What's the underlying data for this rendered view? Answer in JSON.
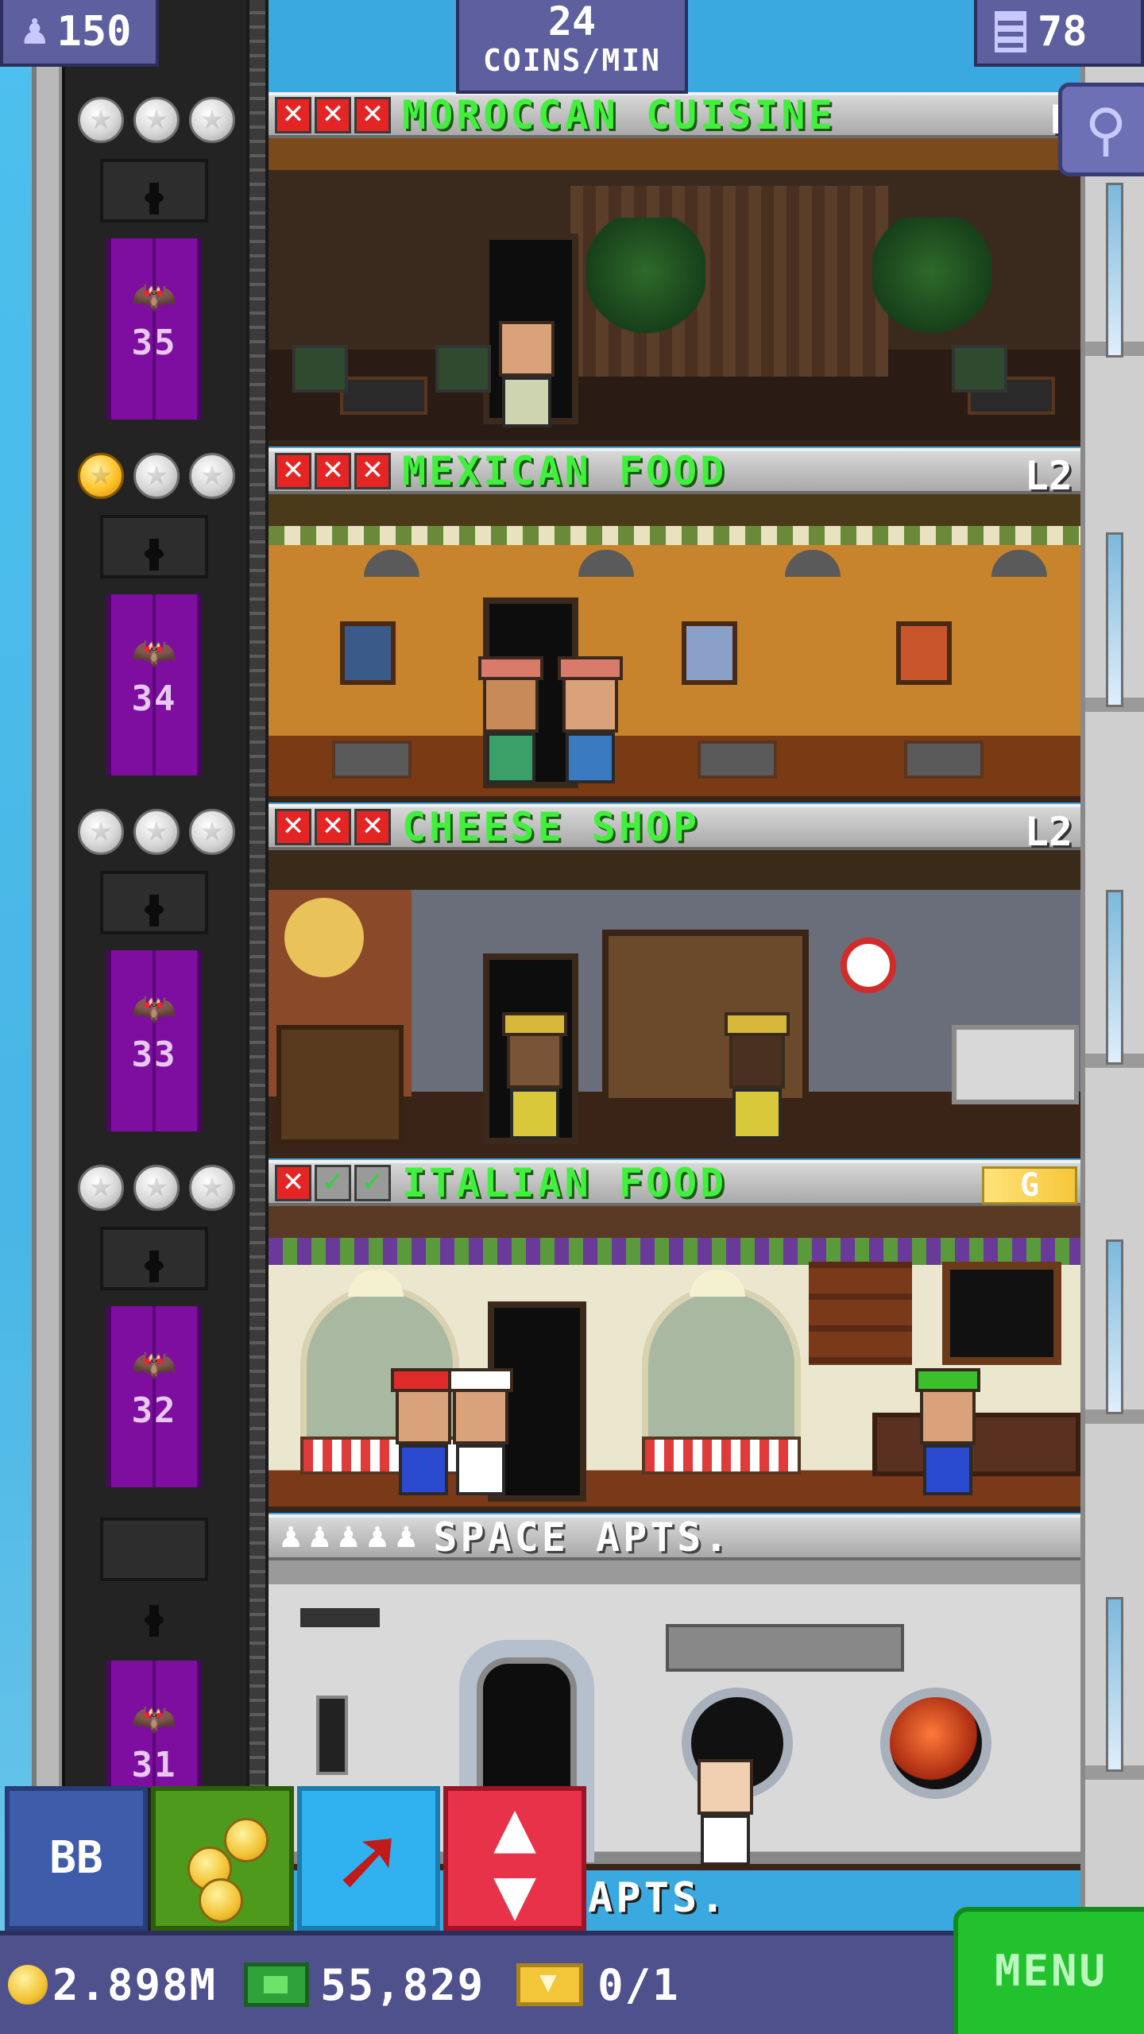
{
  "hud": {
    "population": "150",
    "coins_per_min_value": "24",
    "coins_per_min_label": "COINS/MIN",
    "floor_count": "78"
  },
  "shaft": {
    "floors": [
      {
        "number": "35",
        "stars": [
          "silver",
          "silver",
          "silver"
        ]
      },
      {
        "number": "34",
        "stars": [
          "gold",
          "silver",
          "silver"
        ]
      },
      {
        "number": "33",
        "stars": [
          "silver",
          "silver",
          "silver"
        ]
      },
      {
        "number": "32",
        "stars": [
          "silver",
          "silver",
          "silver"
        ]
      },
      {
        "number": "31",
        "stars": []
      }
    ]
  },
  "rooms": [
    {
      "name": "MOROCCAN CUISINE",
      "level": "L",
      "marks": [
        "x",
        "x",
        "x"
      ],
      "bg": "#3a2a1e"
    },
    {
      "name": "MEXICAN FOOD",
      "level": "L2",
      "marks": [
        "x",
        "x",
        "x"
      ],
      "bg": "#b86a22"
    },
    {
      "name": "CHEESE SHOP",
      "level": "L2",
      "marks": [
        "x",
        "x",
        "x"
      ],
      "bg": "#5a4a3a"
    },
    {
      "name": "ITALIAN FOOD",
      "level": "G",
      "marks": [
        "x",
        "ok",
        "ok"
      ],
      "bg": "#e9e6cf"
    },
    {
      "name": "SPACE APTS.",
      "residents": "♟♟♟♟♟",
      "bg": "#d7d7d7"
    }
  ],
  "lower_room_label": "APTS.",
  "buttons": {
    "bb_label": "BB",
    "menu_label": "MENU"
  },
  "bottom": {
    "coins": "2.898M",
    "bux": "55,829",
    "tickets": "0/1"
  },
  "icons": {
    "population": "person-icon",
    "floors": "building-icon",
    "search": "magnifier-icon",
    "coins": "coin-icon",
    "bux": "bux-icon",
    "ticket": "ticket-icon",
    "rocket": "rocket-icon",
    "elevator": "elevator-arrows-icon"
  }
}
